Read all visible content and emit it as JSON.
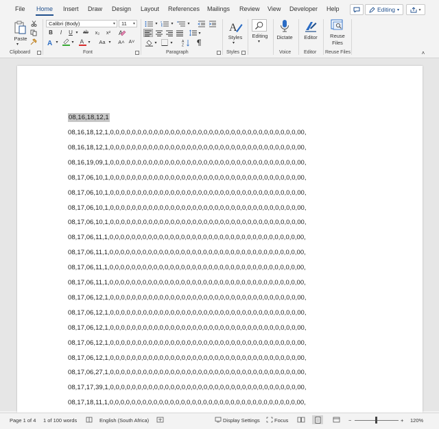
{
  "ribbon_tabs": [
    "File",
    "Home",
    "Insert",
    "Draw",
    "Design",
    "Layout",
    "References",
    "Mailings",
    "Review",
    "View",
    "Developer",
    "Help"
  ],
  "editing_mode": "Editing",
  "font": {
    "name": "Calibri (Body)",
    "size": "11"
  },
  "clipboard": {
    "paste_label": "Paste"
  },
  "styles_label": "Styles",
  "editing_label": "Editing",
  "dictate_label": "Dictate",
  "editor_label": "Editor",
  "reuse_label_1": "Reuse",
  "reuse_label_2": "Files",
  "group_labels": {
    "clipboard": "Clipboard",
    "font": "Font",
    "paragraph": "Paragraph",
    "styles": "Styles",
    "voice": "Voice",
    "editor": "Editor",
    "reuse": "Reuse Files"
  },
  "font_controls": {
    "bold": "B",
    "italic": "I",
    "underline": "U",
    "strike": "ab",
    "subscript": "x₂",
    "superscript": "x²",
    "grow": "A˄",
    "shrink": "A˅",
    "case": "Aa"
  },
  "document": {
    "selected_text": "08,16,18,12,1",
    "lines": [
      "08,16,18,12,1,0,0,0,0,0,0,0,0,0,0,0,0,0,0,0,0,0,0,0,0,0,0,0,0,0,0,0,0,0,0,0,0,0,0,00,",
      "08,16,18,12,1,0,0,0,0,0,0,0,0,0,0,0,0,0,0,0,0,0,0,0,0,0,0,0,0,0,0,0,0,0,0,0,0,0,0,00,",
      "08,16,19,09,1,0,0,0,0,0,0,0,0,0,0,0,0,0,0,0,0,0,0,0,0,0,0,0,0,0,0,0,0,0,0,0,0,0,0,00,",
      "08,17,06,10,1,0,0,0,0,0,0,0,0,0,0,0,0,0,0,0,0,0,0,0,0,0,0,0,0,0,0,0,0,0,0,0,0,0,0,00,",
      "08,17,06,10,1,0,0,0,0,0,0,0,0,0,0,0,0,0,0,0,0,0,0,0,0,0,0,0,0,0,0,0,0,0,0,0,0,0,0,00,",
      "08,17,06,10,1,0,0,0,0,0,0,0,0,0,0,0,0,0,0,0,0,0,0,0,0,0,0,0,0,0,0,0,0,0,0,0,0,0,0,00,",
      "08,17,06,10,1,0,0,0,0,0,0,0,0,0,0,0,0,0,0,0,0,0,0,0,0,0,0,0,0,0,0,0,0,0,0,0,0,0,0,00,",
      "08,17,06,11,1,0,0,0,0,0,0,0,0,0,0,0,0,0,0,0,0,0,0,0,0,0,0,0,0,0,0,0,0,0,0,0,0,0,0,00,",
      "08,17,06,11,1,0,0,0,0,0,0,0,0,0,0,0,0,0,0,0,0,0,0,0,0,0,0,0,0,0,0,0,0,0,0,0,0,0,0,00,",
      "08,17,06,11,1,0,0,0,0,0,0,0,0,0,0,0,0,0,0,0,0,0,0,0,0,0,0,0,0,0,0,0,0,0,0,0,0,0,0,00,",
      "08,17,06,11,1,0,0,0,0,0,0,0,0,0,0,0,0,0,0,0,0,0,0,0,0,0,0,0,0,0,0,0,0,0,0,0,0,0,0,00,",
      "08,17,06,12,1,0,0,0,0,0,0,0,0,0,0,0,0,0,0,0,0,0,0,0,0,0,0,0,0,0,0,0,0,0,0,0,0,0,0,00,",
      "08,17,06,12,1,0,0,0,0,0,0,0,0,0,0,0,0,0,0,0,0,0,0,0,0,0,0,0,0,0,0,0,0,0,0,0,0,0,0,00,",
      "08,17,06,12,1,0,0,0,0,0,0,0,0,0,0,0,0,0,0,0,0,0,0,0,0,0,0,0,0,0,0,0,0,0,0,0,0,0,0,00,",
      "08,17,06,12,1,0,0,0,0,0,0,0,0,0,0,0,0,0,0,0,0,0,0,0,0,0,0,0,0,0,0,0,0,0,0,0,0,0,0,00,",
      "08,17,06,12,1,0,0,0,0,0,0,0,0,0,0,0,0,0,0,0,0,0,0,0,0,0,0,0,0,0,0,0,0,0,0,0,0,0,0,00,",
      "08,17,06,27,1,0,0,0,0,0,0,0,0,0,0,0,0,0,0,0,0,0,0,0,0,0,0,0,0,0,0,0,0,0,0,0,0,0,0,00,",
      "08,17,17,39,1,0,0,0,0,0,0,0,0,0,0,0,0,0,0,0,0,0,0,0,0,0,0,0,0,0,0,0,0,0,0,0,0,0,0,00,",
      "08,17,18,11,1,0,0,0,0,0,0,0,0,0,0,0,0,0,0,0,0,0,0,0,0,0,0,0,0,0,0,0,0,0,0,0,0,0,0,00,"
    ]
  },
  "status_bar": {
    "page": "Page 1 of 4",
    "words": "1 of 100 words",
    "language": "English (South Africa)",
    "display_settings": "Display Settings",
    "focus": "Focus",
    "zoom_minus": "−",
    "zoom_plus": "+",
    "zoom": "120%"
  },
  "colors": {
    "accent": "#1e4e8c",
    "highlight_green": "#3aaa35",
    "font_color_red": "#d62a2a",
    "ribbon_bg": "#f3f3f3"
  }
}
